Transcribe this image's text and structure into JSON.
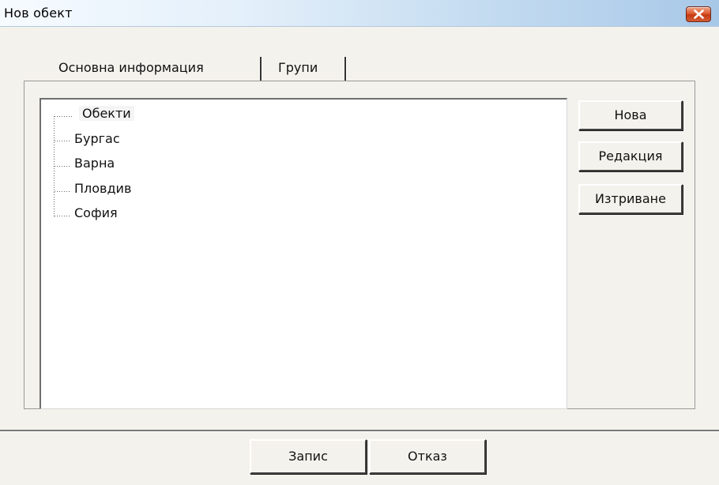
{
  "window": {
    "title": "Нов обект",
    "close_icon": "close-icon"
  },
  "tabs": [
    {
      "label": "Основна информация"
    },
    {
      "label": "Групи",
      "active": true
    }
  ],
  "tree": {
    "root": "Обекти",
    "items": [
      {
        "label": "Бургас"
      },
      {
        "label": "Варна"
      },
      {
        "label": "Пловдив"
      },
      {
        "label": "София"
      }
    ]
  },
  "side_buttons": {
    "new": "Нова",
    "edit": "Редакция",
    "delete": "Изтриване"
  },
  "footer": {
    "save": "Запис",
    "cancel": "Отказ"
  }
}
